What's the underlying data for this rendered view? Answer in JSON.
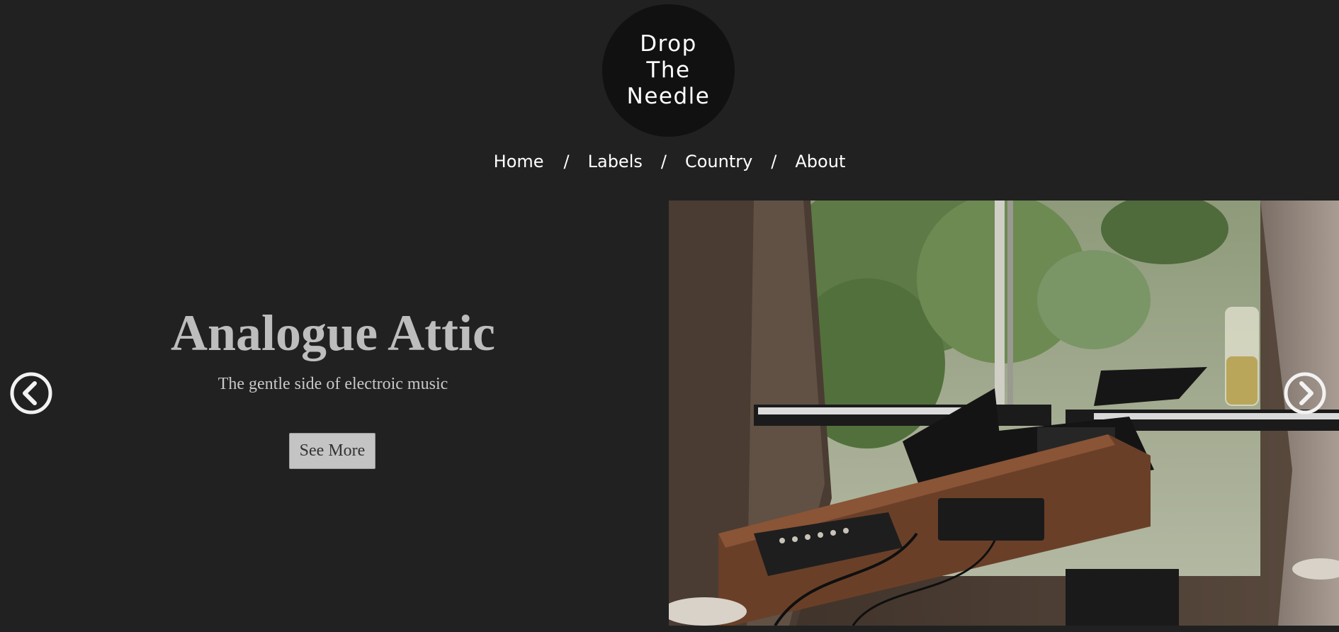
{
  "brand": {
    "logo_lines": [
      "Drop",
      "The",
      "Needle"
    ]
  },
  "nav": {
    "items": [
      {
        "label": "Home"
      },
      {
        "label": "Labels"
      },
      {
        "label": "Country"
      },
      {
        "label": "About"
      }
    ],
    "separator": "/"
  },
  "slide": {
    "title": "Analogue Attic",
    "subtitle": "The gentle side of electroic music",
    "button_label": "See More",
    "image_icon": "studio-photo"
  },
  "colors": {
    "background": "#212121",
    "logo_bg": "#111111",
    "button_bg": "#c4c4c4",
    "title": "#bdbdbd"
  },
  "icons": {
    "prev": "chevron-left-circle-icon",
    "next": "chevron-right-circle-icon"
  }
}
